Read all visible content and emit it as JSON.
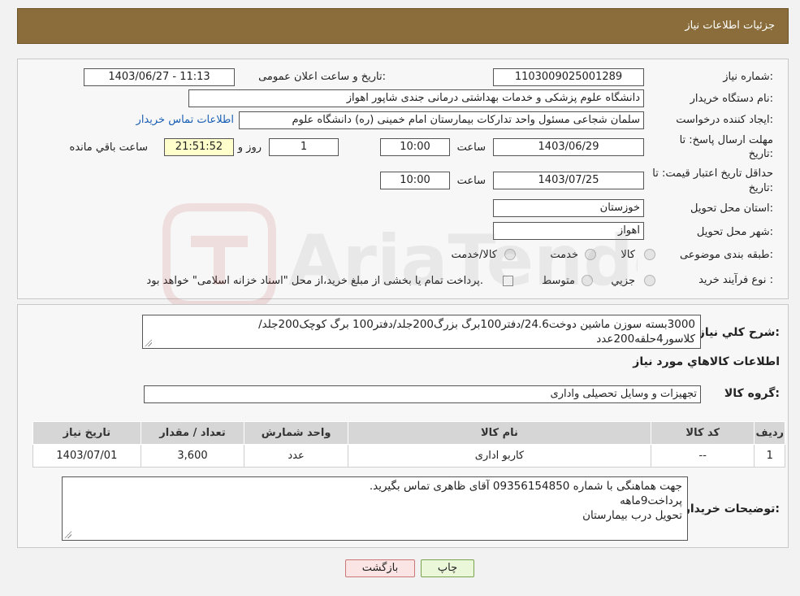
{
  "header": {
    "title": "جزئیات اطلاعات نیاز"
  },
  "info": {
    "need_number_label": "شماره نیاز:",
    "need_number": "1103009025001289",
    "announce_label": "تاریخ و ساعت اعلان عمومی:",
    "announce_value": "1403/06/27 - 11:13",
    "buyer_org_label": "نام دستگاه خریدار:",
    "buyer_org": "دانشگاه علوم پزشکی و خدمات بهداشتی درمانی جندی شاپور اهواز",
    "creator_label": "ایجاد کننده درخواست:",
    "creator": "سلمان شجاعی مسئول واحد تدارکات بیمارستان امام خمینی (ره) دانشگاه علوم",
    "contact_link": "اطلاعات تماس خریدار",
    "deadline_label_1": "مهلت ارسال پاسخ: تا",
    "deadline_label_2": "تاریخ:",
    "deadline_date": "1403/06/29",
    "time_label": "ساعت",
    "deadline_time": "10:00",
    "days_value": "1",
    "days_label": "روز و",
    "remaining_time": "21:51:52",
    "remaining_label": "ساعت باقي مانده",
    "validity_label_1": "حداقل تاریخ اعتبار قیمت: تا",
    "validity_label_2": "تاریخ:",
    "validity_date": "1403/07/25",
    "validity_time": "10:00",
    "province_label": "استان محل تحویل:",
    "province": "خوزستان",
    "city_label": "شهر محل تحویل:",
    "city": "اهواز",
    "category_label": "طبقه بندی موضوعی:",
    "category_options": [
      "کالا",
      "خدمت",
      "کالا/خدمت"
    ],
    "process_label": "نوع فرآیند خرید :",
    "process_options": [
      "جزیي",
      "متوسط"
    ],
    "process_note": "پرداخت تمام یا بخشی از مبلغ خرید،از محل \"اسناد خزانه اسلامی\" خواهد بود."
  },
  "items": {
    "summary_label": "شرح کلي نياز:",
    "summary_line1": "3000بسته سوزن ماشین دوخت24.6/دفتر100برگ بزرگ200جلد/دفتر100 برگ کوچک200جلد/",
    "summary_line2": "کلاسور4حلقه200عدد",
    "section_title": "اطلاعات کالاهاي مورد نياز",
    "group_label": "گروه کالا:",
    "group_value": "تجهیزات و وسایل تحصیلی واداری",
    "table": {
      "headers": [
        "رديف",
        "کد کالا",
        "نام کالا",
        "واحد شمارش",
        "تعداد / مقدار",
        "تاریخ نیاز"
      ],
      "rows": [
        [
          "1",
          "--",
          "کاربو اداری",
          "عدد",
          "3,600",
          "1403/07/01"
        ]
      ]
    },
    "notes_label": "توضيحات خريدار:",
    "notes_line1": "جهت هماهنگی با شماره 09356154850 آقای ظاهری تماس بگیرید.",
    "notes_line2": "پرداخت9ماهه",
    "notes_line3": "تحویل درب بیمارستان"
  },
  "buttons": {
    "print": "چاپ",
    "back": "بازگشت"
  },
  "watermark_text": "AriaTender.neT"
}
